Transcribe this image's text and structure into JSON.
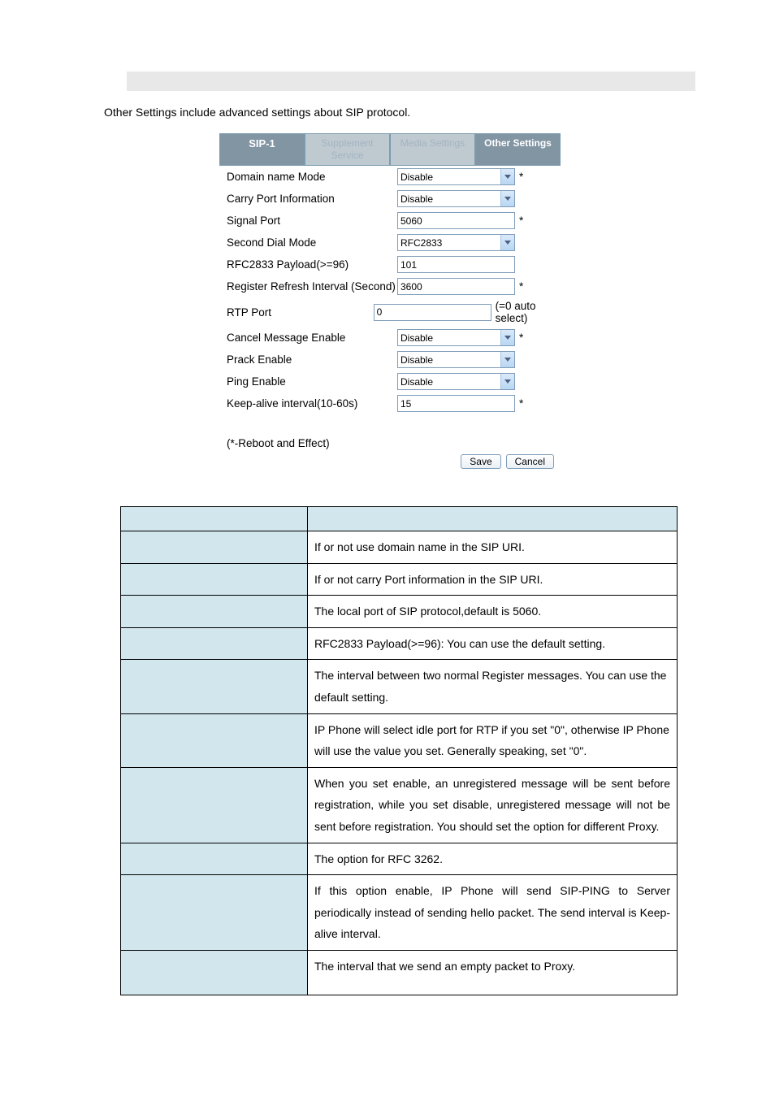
{
  "header": {
    "title": ""
  },
  "intro": "Other Settings include advanced settings about SIP protocol.",
  "tabs": [
    {
      "label": "SIP-1",
      "active": true
    },
    {
      "label": "Supplement Service",
      "active": false
    },
    {
      "label": "Media Settings",
      "active": false
    },
    {
      "label": "Other Settings",
      "active": true
    }
  ],
  "form": {
    "rows": [
      {
        "label": "Domain name Mode",
        "type": "select",
        "value": "Disable",
        "note": "*"
      },
      {
        "label": "Carry Port Information",
        "type": "select",
        "value": "Disable",
        "note": ""
      },
      {
        "label": "Signal Port",
        "type": "input",
        "value": "5060",
        "note": "*"
      },
      {
        "label": "Second Dial Mode",
        "type": "select",
        "value": "RFC2833",
        "note": ""
      },
      {
        "label": "RFC2833 Payload(>=96)",
        "type": "input",
        "value": "101",
        "note": ""
      },
      {
        "label": "Register Refresh Interval (Second)",
        "type": "input",
        "value": "3600",
        "note": "*"
      },
      {
        "label": "RTP Port",
        "type": "input",
        "value": "0",
        "note": "(=0 auto select)"
      },
      {
        "label": "Cancel Message Enable",
        "type": "select",
        "value": "Disable",
        "note": "*"
      },
      {
        "label": "Prack Enable",
        "type": "select",
        "value": "Disable",
        "note": ""
      },
      {
        "label": "Ping Enable",
        "type": "select",
        "value": "Disable",
        "note": ""
      },
      {
        "label": "Keep-alive interval(10-60s)",
        "type": "input",
        "value": "15",
        "note": "*"
      }
    ],
    "reboot_note": "(*-Reboot and Effect)",
    "save_label": "Save",
    "cancel_label": "Cancel"
  },
  "desc_table": {
    "rows": [
      {
        "name": "",
        "desc": ""
      },
      {
        "name": "",
        "desc": "If or not use domain name in the SIP URI."
      },
      {
        "name": "",
        "desc": "If or not carry Port information in the SIP URI."
      },
      {
        "name": "",
        "desc": "The local port of SIP protocol,default is 5060."
      },
      {
        "name": "",
        "desc": "RFC2833 Payload(>=96): You can use the default setting."
      },
      {
        "name": "",
        "desc": "The interval between two normal Register messages. You can use the default setting."
      },
      {
        "name": "",
        "desc": "IP Phone will select idle port for RTP if you set \"0\", otherwise IP Phone will use the value you set. Generally speaking, set \"0\"."
      },
      {
        "name": "",
        "desc": "When you set enable, an unregistered message will be sent before registration, while you set disable, unregistered message will not be sent before registration. You should set the option for different Proxy."
      },
      {
        "name": "",
        "desc": "The option for RFC 3262."
      },
      {
        "name": "",
        "desc": "If this option enable, IP Phone will send SIP-PING to Server periodically instead of sending hello packet. The send interval is Keep-alive interval."
      },
      {
        "name": "",
        "desc": "The interval that we send an empty packet to Proxy."
      }
    ]
  }
}
